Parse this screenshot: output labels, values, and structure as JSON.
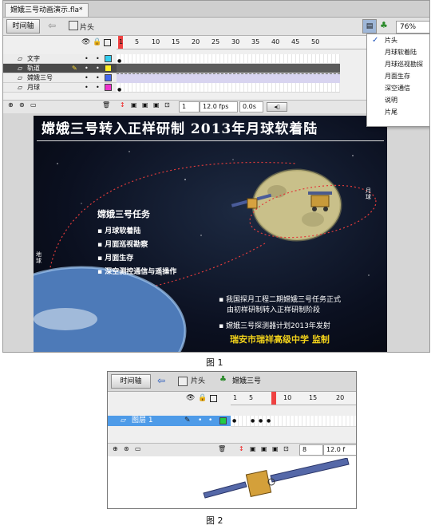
{
  "figure1": {
    "window_tab": "嫦娥三号动画演示.fla*",
    "timeline_button": "时间轴",
    "scene_label": "片头",
    "zoom_value": "76%",
    "scene_menu": [
      "片头",
      "月球软着陆",
      "月球巡视勘探",
      "月面生存",
      "深空通信",
      "说明",
      "片尾"
    ],
    "scene_menu_selected": 0,
    "ruler_numbers": [
      "1",
      "5",
      "10",
      "15",
      "20",
      "25",
      "30",
      "35",
      "40",
      "45",
      "50"
    ],
    "layers": [
      {
        "name": "文字",
        "color": "#33ccee"
      },
      {
        "name": "轨道",
        "color": "#ffee22",
        "selected": true
      },
      {
        "name": "嫦娥三号",
        "color": "#4466ee"
      },
      {
        "name": "月球",
        "color": "#ee33cc"
      }
    ],
    "status": {
      "frame": "1",
      "fps": "12.0 fps",
      "time": "0.0s"
    },
    "stage": {
      "title": "嫦娥三号转入正样研制   2013年月球软着陆",
      "task_title": "嫦娥三号任务",
      "tasks": [
        "月球软着陆",
        "月面巡视勘察",
        "月面生存",
        "深空测控通信与遥操作"
      ],
      "info1_line1": "我国探月工程二期嫦娥三号任务正式",
      "info1_line2": "由初样研制转入正样研制阶段",
      "info2": "嫦娥三号探测器计划2013年发射",
      "school": "瑞安市瑞祥高级中学   监制",
      "earth_label": "地\n球",
      "moon_label": "月\n球"
    },
    "caption": "图 1"
  },
  "figure2": {
    "timeline_button": "时间轴",
    "scene": "片头",
    "symbol": "嫦娥三号",
    "ruler_numbers": [
      "1",
      "5",
      "10",
      "15",
      "20"
    ],
    "layer": "图层 1",
    "frame_field": "8",
    "fps_field": "12.0 f",
    "caption": "图 2"
  },
  "colors": {
    "selection": "#4a4a4a",
    "playhead": "#ee2222",
    "stage_text_yellow": "#f2d21a"
  }
}
